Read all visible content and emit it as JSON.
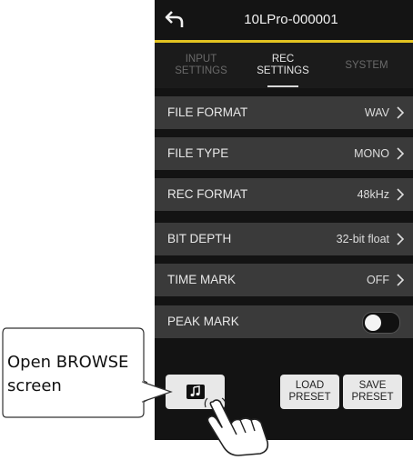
{
  "header": {
    "title": "10LPro-000001"
  },
  "tabs": [
    {
      "label": "INPUT\nSETTINGS",
      "active": false
    },
    {
      "label": "REC\nSETTINGS",
      "active": true
    },
    {
      "label": "SYSTEM",
      "active": false
    }
  ],
  "rows": [
    {
      "label": "FILE FORMAT",
      "value": "WAV"
    },
    {
      "label": "FILE TYPE",
      "value": "MONO"
    },
    {
      "label": "REC FORMAT",
      "value": "48kHz"
    },
    {
      "label": "BIT DEPTH",
      "value": "32-bit float"
    },
    {
      "label": "TIME MARK",
      "value": "OFF"
    }
  ],
  "peak_mark": {
    "label": "PEAK MARK",
    "state": "off"
  },
  "buttons": {
    "browse_icon": "music-note-icon",
    "load": "LOAD\nPRESET",
    "save": "SAVE\nPRESET"
  },
  "callout": {
    "text": "Open BROWSE\nscreen"
  },
  "colors": {
    "accent": "#e3c321",
    "row_bg": "#3a3a3a",
    "screen_bg": "#131313"
  }
}
